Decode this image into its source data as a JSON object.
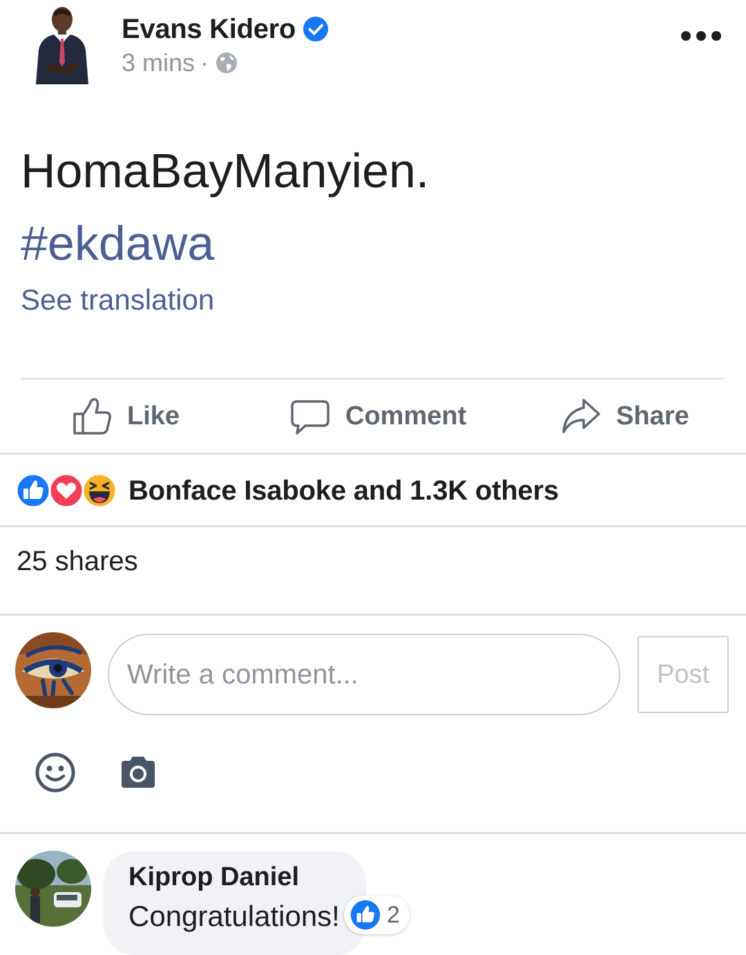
{
  "post": {
    "author": "Evans Kidero",
    "time": "3 mins",
    "separator": "·",
    "text": "HomaBayManyien.",
    "hashtag": "#ekdawa",
    "see_translation": "See translation"
  },
  "actions": {
    "like": "Like",
    "comment": "Comment",
    "share": "Share"
  },
  "reactions": {
    "summary": "Bonface Isaboke and 1.3K others",
    "icons": [
      "like-icon",
      "love-icon",
      "haha-icon"
    ]
  },
  "shares": "25 shares",
  "composer": {
    "placeholder": "Write a comment...",
    "post_label": "Post"
  },
  "comments": [
    {
      "author": "Kiprop Daniel",
      "text": "Congratulations!",
      "reaction_count": "2"
    }
  ],
  "colors": {
    "link": "#4b5f93",
    "facebook_blue": "#1877f2",
    "love_red": "#f33e58",
    "haha_yellow": "#f7b125",
    "muted": "#90949c"
  }
}
